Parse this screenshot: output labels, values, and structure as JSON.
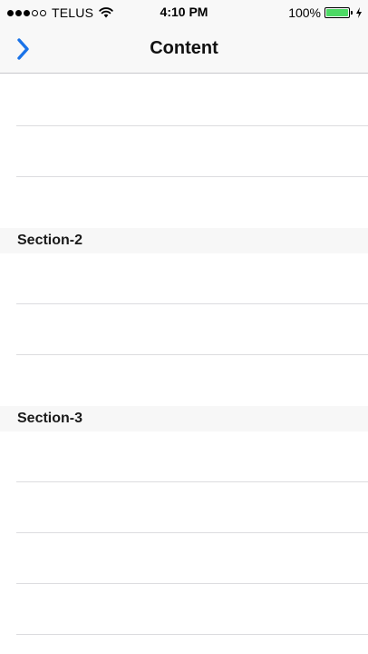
{
  "status_bar": {
    "carrier": "TELUS",
    "time": "4:10 PM",
    "battery": "100%",
    "signal_bars_filled": 3,
    "signal_bars_total": 5,
    "battery_color": "#4cd964",
    "icons": [
      "signal-dots-icon",
      "wifi-icon",
      "battery-icon",
      "charging-bolt-icon"
    ]
  },
  "nav": {
    "title": "Content",
    "back_icon": "chevron-right-icon",
    "accent_color": "#1a73e8"
  },
  "sections": [
    {
      "header": "",
      "rows": [
        "",
        "",
        ""
      ]
    },
    {
      "header": "Section-2",
      "rows": [
        "",
        "",
        ""
      ]
    },
    {
      "header": "Section-3",
      "rows": [
        "",
        "",
        "",
        ""
      ]
    }
  ]
}
